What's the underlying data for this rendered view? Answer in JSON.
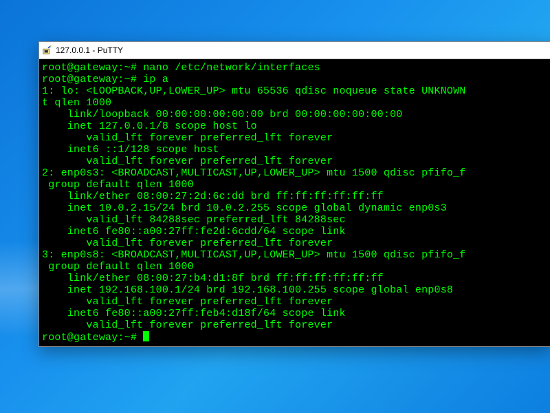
{
  "titlebar": {
    "icon_name": "putty-icon",
    "title": "127.0.0.1 - PuTTY"
  },
  "terminal": {
    "lines": [
      "root@gateway:~# nano /etc/network/interfaces",
      "root@gateway:~# ip a",
      "1: lo: <LOOPBACK,UP,LOWER_UP> mtu 65536 qdisc noqueue state UNKNOWN",
      "t qlen 1000",
      "    link/loopback 00:00:00:00:00:00 brd 00:00:00:00:00:00",
      "    inet 127.0.0.1/8 scope host lo",
      "       valid_lft forever preferred_lft forever",
      "    inet6 ::1/128 scope host",
      "       valid_lft forever preferred_lft forever",
      "2: enp0s3: <BROADCAST,MULTICAST,UP,LOWER_UP> mtu 1500 qdisc pfifo_f",
      " group default qlen 1000",
      "    link/ether 08:00:27:2d:6c:dd brd ff:ff:ff:ff:ff:ff",
      "    inet 10.0.2.15/24 brd 10.0.2.255 scope global dynamic enp0s3",
      "       valid_lft 84288sec preferred_lft 84288sec",
      "    inet6 fe80::a00:27ff:fe2d:6cdd/64 scope link",
      "       valid_lft forever preferred_lft forever",
      "3: enp0s8: <BROADCAST,MULTICAST,UP,LOWER_UP> mtu 1500 qdisc pfifo_f",
      " group default qlen 1000",
      "    link/ether 08:00:27:b4:d1:8f brd ff:ff:ff:ff:ff:ff",
      "    inet 192.168.100.1/24 brd 192.168.100.255 scope global enp0s8",
      "       valid_lft forever preferred_lft forever",
      "    inet6 fe80::a00:27ff:feb4:d18f/64 scope link",
      "       valid_lft forever preferred_lft forever"
    ],
    "prompt": "root@gateway:~# "
  }
}
